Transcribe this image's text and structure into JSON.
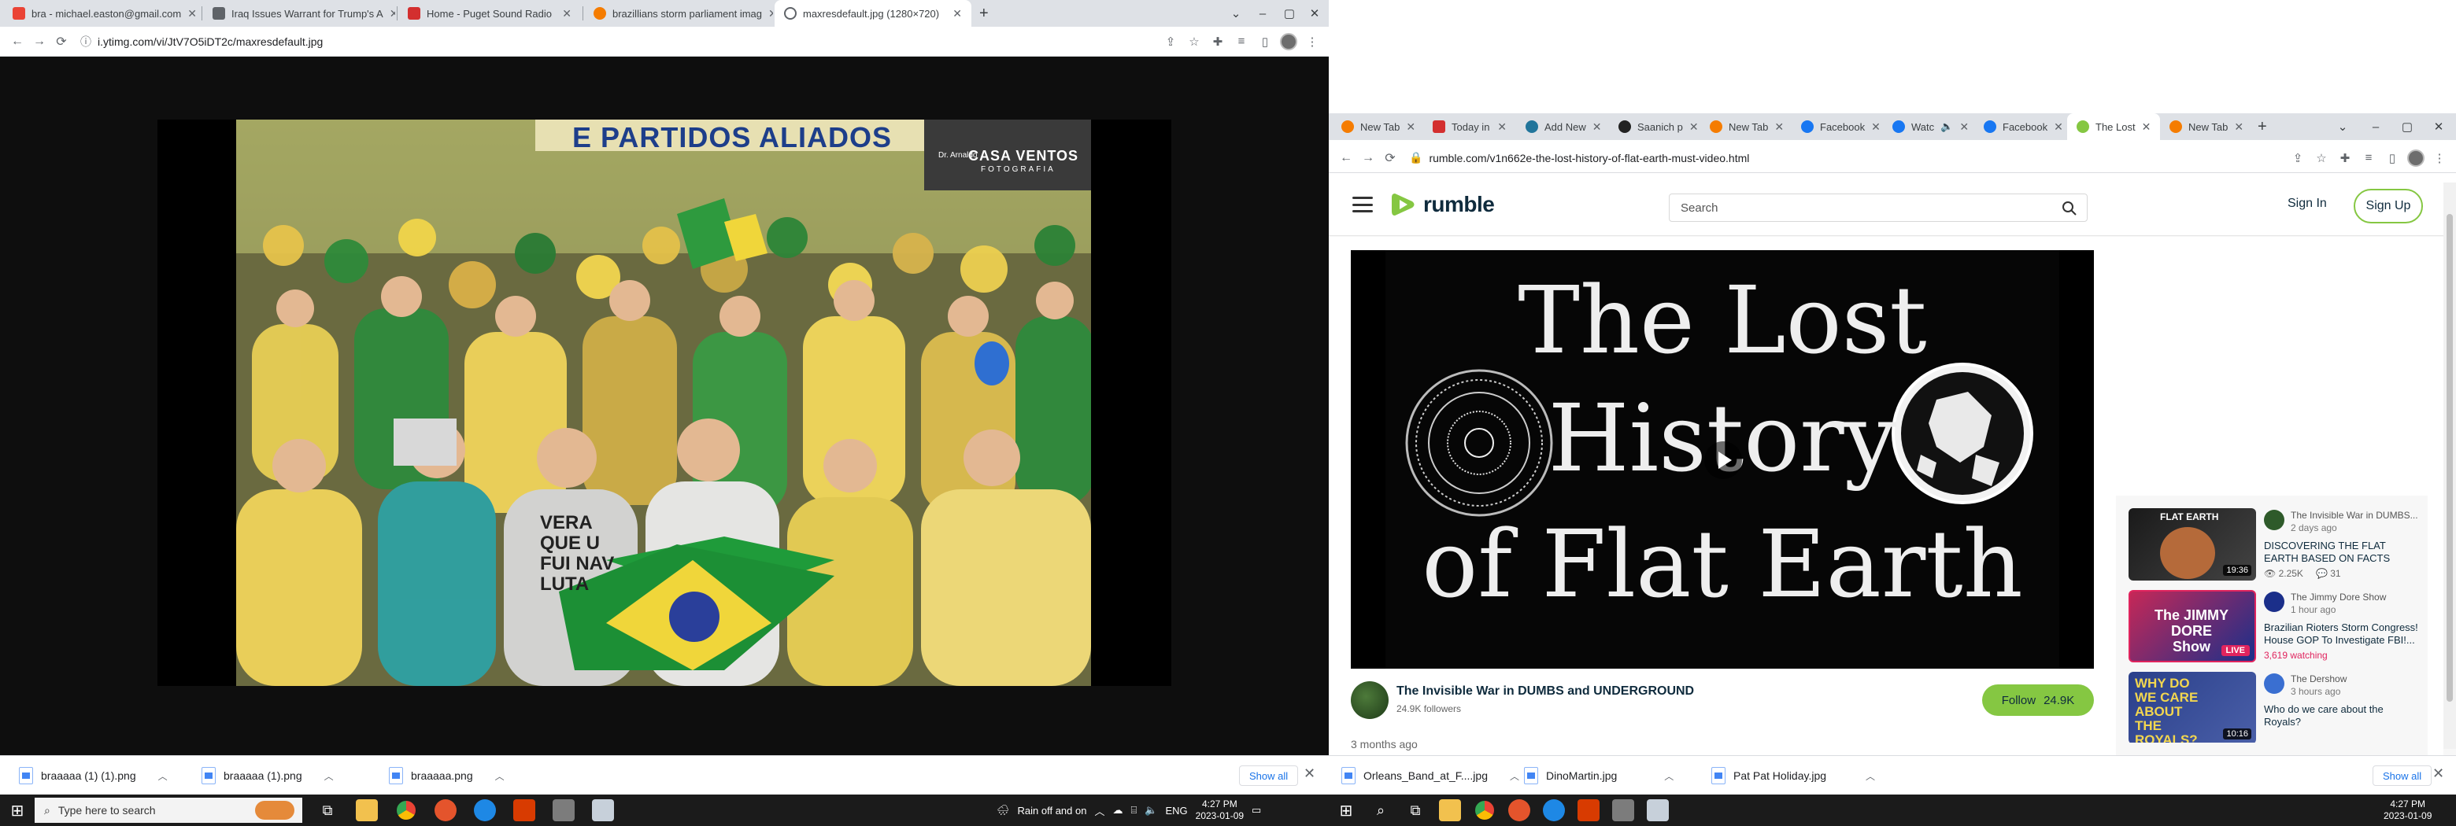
{
  "left_browser": {
    "tabs": [
      {
        "label": "bra - michael.easton@gmail.com",
        "color": "#ea4335"
      },
      {
        "label": "Iraq Issues Warrant for Trump's A",
        "color": "#5f6368"
      },
      {
        "label": "Home - Puget Sound Radio",
        "color": "#d32f2f"
      },
      {
        "label": "brazillians storm parliament imag",
        "color": "#f57c00"
      },
      {
        "label": "maxresdefault.jpg (1280×720)",
        "color": "#5f6368"
      }
    ],
    "url": "i.ytimg.com/vi/JtV7O5iDT2c/maxresdefault.jpg",
    "image_banner": "E PARTIDOS ALIADOS",
    "image_watermark_title": "CASA VENTOS",
    "image_watermark_sub": "FOTOGRAFIA",
    "image_street_sign": "Dr. Arnaldo",
    "shirt_text": "VERA QUE U FUI NAV LUTA",
    "downloads": [
      {
        "name": "braaaaa (1) (1).png"
      },
      {
        "name": "braaaaa (1).png"
      },
      {
        "name": "braaaaa.png"
      }
    ],
    "show_all": "Show all"
  },
  "right_browser": {
    "tabs": [
      {
        "label": "New Tab",
        "color": "#f57c00"
      },
      {
        "label": "Today in",
        "color": "#d32f2f"
      },
      {
        "label": "Add New",
        "color": "#21759b"
      },
      {
        "label": "Saanich p",
        "color": "#222222"
      },
      {
        "label": "New Tab",
        "color": "#f57c00"
      },
      {
        "label": "Facebook",
        "color": "#1877f2"
      },
      {
        "label": "Watc",
        "color": "#1877f2"
      },
      {
        "label": "Facebook",
        "color": "#1877f2"
      },
      {
        "label": "The Lost",
        "color": "#85c742"
      },
      {
        "label": "New Tab",
        "color": "#f57c00"
      }
    ],
    "url": "rumble.com/v1n662e-the-lost-history-of-flat-earth-must-video.html",
    "logo_text": "rumble",
    "search_placeholder": "Search",
    "sign_in": "Sign In",
    "sign_up": "Sign Up",
    "video_title_lines": [
      "The Lost",
      "History",
      "of Flat Earth"
    ],
    "channel_name": "The Invisible War in DUMBS and UNDERGROUND",
    "followers": "24.9K followers",
    "follow_label": "Follow",
    "follow_count": "24.9K",
    "posted_ago": "3 months ago",
    "recommended": [
      {
        "channel": "The Invisible War in DUMBS...",
        "time": "2 days ago",
        "title": "DISCOVERING THE FLAT EARTH BASED ON FACTS",
        "views": "2.25K",
        "comments": "31",
        "duration": "19:36",
        "thumb_text": "FLAT EARTH"
      },
      {
        "channel": "The Jimmy Dore Show",
        "time": "1 hour ago",
        "title": "Brazilian Rioters Storm Congress! House GOP To Investigate FBI!...",
        "watching": "3,619 watching",
        "badge": "LIVE",
        "thumb_text": "The JIMMY DORE Show"
      },
      {
        "channel": "The Dershow",
        "time": "3 hours ago",
        "title": "Who do we care about the Royals?",
        "duration": "10:16",
        "thumb_text": "WHY DO WE CARE ABOUT THE ROYALS?"
      }
    ],
    "downloads": [
      {
        "name": "Orleans_Band_at_F....jpg"
      },
      {
        "name": "DinoMartin.jpg"
      },
      {
        "name": "Pat Pat Holiday.jpg"
      }
    ],
    "show_all": "Show all"
  },
  "taskbar_left": {
    "search_placeholder": "Type here to search",
    "weather": "Rain off and on",
    "lang": "ENG",
    "time": "4:27 PM",
    "date": "2023-01-09"
  },
  "taskbar_right": {
    "time": "4:27 PM",
    "date": "2023-01-09"
  }
}
